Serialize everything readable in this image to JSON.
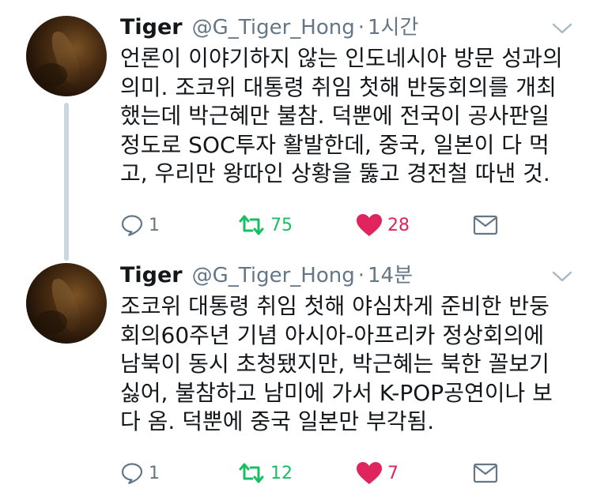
{
  "tweets": [
    {
      "name": "Tiger",
      "handle": "@G_Tiger_Hong",
      "separator": "·",
      "time": "1시간",
      "lines": [
        "언론이 이야기하지 않는 인도네시아 방문 성과의",
        "의미. 조코위 대통령 취임 첫해 반둥회의를 개최",
        "했는데 박근혜만 불참. 덕뿐에 전국이 공사판일",
        "정도로 SOC투자 활발한데, 중국, 일본이 다 먹",
        "고, 우리만 왕따인 상황을 뚫고 경전철 따낸 것."
      ],
      "replies": "1",
      "retweets": "75",
      "likes": "28",
      "icons": {
        "reply": "reply-icon",
        "retweet": "retweet-icon",
        "like": "heart-icon",
        "dm": "envelope-icon",
        "menu": "chevron-down-icon"
      }
    },
    {
      "name": "Tiger",
      "handle": "@G_Tiger_Hong",
      "separator": "·",
      "time": "14분",
      "lines": [
        "조코위 대통령 취임 첫해 야심차게 준비한 반둥",
        "회의60주년 기념 아시아-아프리카 정상회의에",
        "남북이 동시 초청됐지만, 박근혜는 북한 꼴보기",
        "싫어, 불참하고 남미에 가서 K-POP공연이나 보",
        "다 옴. 덕뿐에 중국 일본만 부각됨."
      ],
      "replies": "1",
      "retweets": "12",
      "likes": "7",
      "icons": {
        "reply": "reply-icon",
        "retweet": "retweet-icon",
        "like": "heart-icon",
        "dm": "envelope-icon",
        "menu": "chevron-down-icon"
      }
    }
  ],
  "colors": {
    "text": "#14171a",
    "secondary": "#657786",
    "retweet": "#17bf63",
    "like": "#e0245e",
    "thread_line": "#ccd6dd"
  }
}
